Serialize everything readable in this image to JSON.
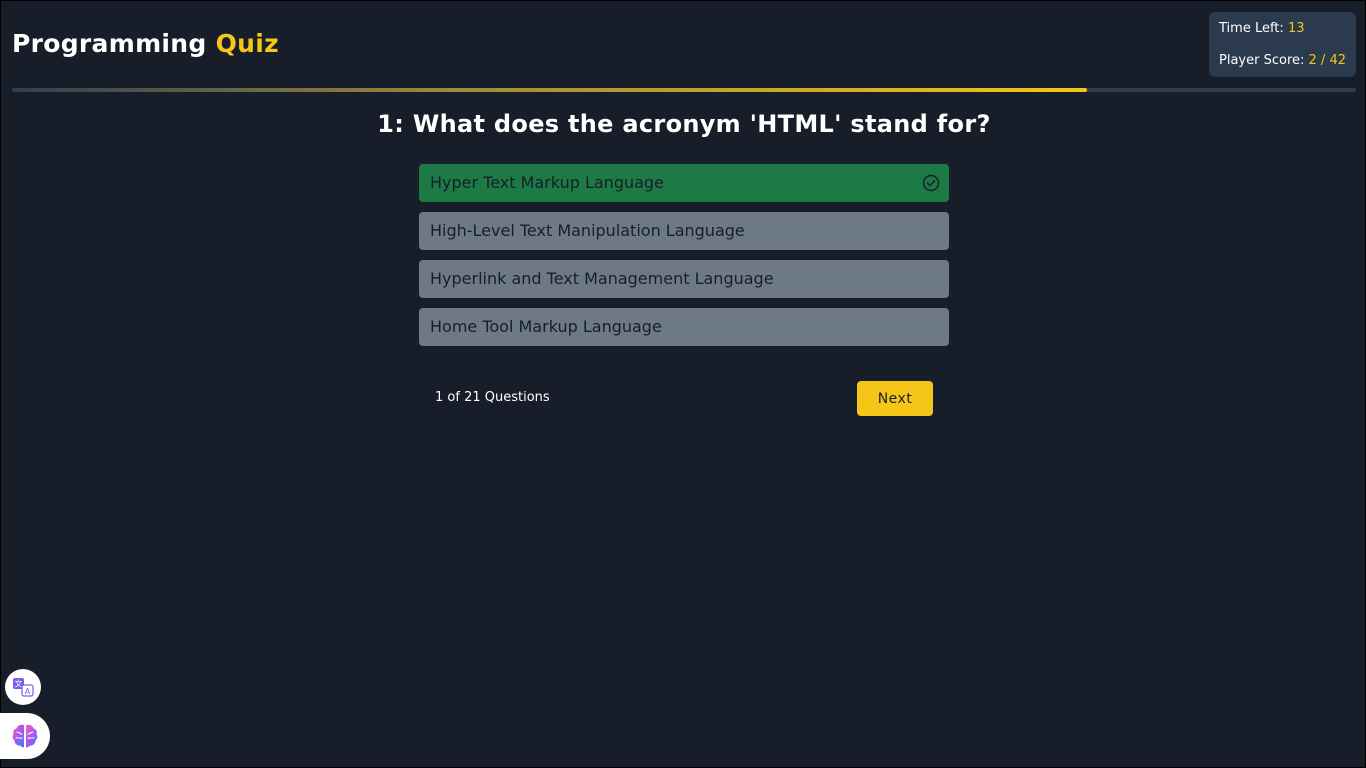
{
  "header": {
    "title_main": "Programming",
    "title_accent": "Quiz"
  },
  "stats": {
    "time_label": "Time Left:",
    "time_value": "13",
    "score_label": "Player Score:",
    "score_value": "2 / 42"
  },
  "progress": {
    "fraction": 0.8
  },
  "question": {
    "text": "1: What does the acronym 'HTML' stand for?"
  },
  "options": [
    {
      "label": "Hyper Text Markup Language",
      "state": "correct"
    },
    {
      "label": "High-Level Text Manipulation Language",
      "state": "disabled"
    },
    {
      "label": "Hyperlink and Text Management Language",
      "state": "disabled"
    },
    {
      "label": "Home Tool Markup Language",
      "state": "disabled"
    }
  ],
  "footer": {
    "counter": "1 of 21 Questions",
    "next_label": "Next"
  },
  "floating": {
    "translate_icon": "translate-icon",
    "brain_icon": "brain-icon"
  },
  "colors": {
    "background": "#171e2a",
    "accent": "#f5c518",
    "correct": "#1d7a45",
    "option_disabled": "#6e7987"
  }
}
